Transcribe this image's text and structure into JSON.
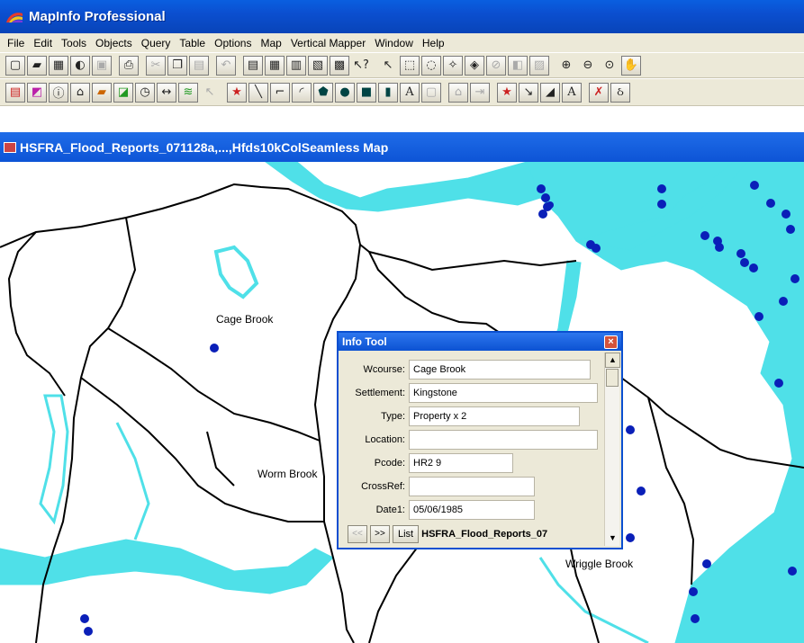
{
  "app": {
    "title": "MapInfo Professional"
  },
  "menu": [
    "File",
    "Edit",
    "Tools",
    "Objects",
    "Query",
    "Table",
    "Options",
    "Map",
    "Vertical Mapper",
    "Window",
    "Help"
  ],
  "toolbar1_icons": [
    "new-icon",
    "open-icon",
    "open-workspace-icon",
    "open-dbms-icon",
    "save-icon",
    "print-icon",
    "cut-icon",
    "copy-icon",
    "paste-icon",
    "undo-icon",
    "new-browser-icon",
    "new-mapper-icon",
    "new-grapher-icon",
    "new-layout-icon",
    "new-redistrict-icon",
    "help-icon",
    "select-icon",
    "marquee-select-icon",
    "radius-select-icon",
    "polygon-select-icon",
    "boundary-select-icon",
    "unselect-icon",
    "invert-select-icon",
    "graph-select-icon",
    "zoom-in-icon",
    "zoom-out-icon",
    "change-view-icon",
    "grabber-icon"
  ],
  "toolbar2_icons": [
    "layer-control-icon",
    "thematic-icon",
    "info-icon",
    "hotlink-icon",
    "label-icon",
    "drag-map-icon",
    "ruler-icon",
    "legend-icon",
    "statistics-icon",
    "pointer-icon",
    "symbol-icon",
    "line-icon",
    "polyline-icon",
    "arc-icon",
    "polygon-icon",
    "ellipse-icon",
    "rectangle-icon",
    "rounded-rectangle-icon",
    "text-icon",
    "frame-icon",
    "reshape-icon",
    "add-node-icon",
    "symbol-style-icon",
    "line-style-icon",
    "region-style-icon",
    "text-style-icon",
    "tool-a-icon",
    "tool-b-icon"
  ],
  "map_window": {
    "title": "HSFRA_Flood_Reports_071128a,...,Hfds10kColSeamless Map"
  },
  "map_labels": {
    "cage_brook": "Cage Brook",
    "worm_brook": "Worm Brook",
    "wriggle_brook": "Wriggle Brook"
  },
  "info_tool": {
    "title": "Info Tool",
    "close": "×",
    "fields": [
      {
        "label": "Wcourse:",
        "value": "Cage Brook"
      },
      {
        "label": "Settlement:",
        "value": "Kingstone"
      },
      {
        "label": "Type:",
        "value": "Property x 2"
      },
      {
        "label": "Location:",
        "value": ""
      },
      {
        "label": "Pcode:",
        "value": "HR2 9"
      },
      {
        "label": "CrossRef:",
        "value": ""
      },
      {
        "label": "Date1:",
        "value": "05/06/1985"
      }
    ],
    "prev": "<<",
    "next": ">>",
    "list": "List",
    "table_name": "HSFRA_Flood_Reports_07"
  },
  "colors": {
    "water": "#4fe0e8",
    "points": "#0a1fb8",
    "boundary": "#000000"
  }
}
